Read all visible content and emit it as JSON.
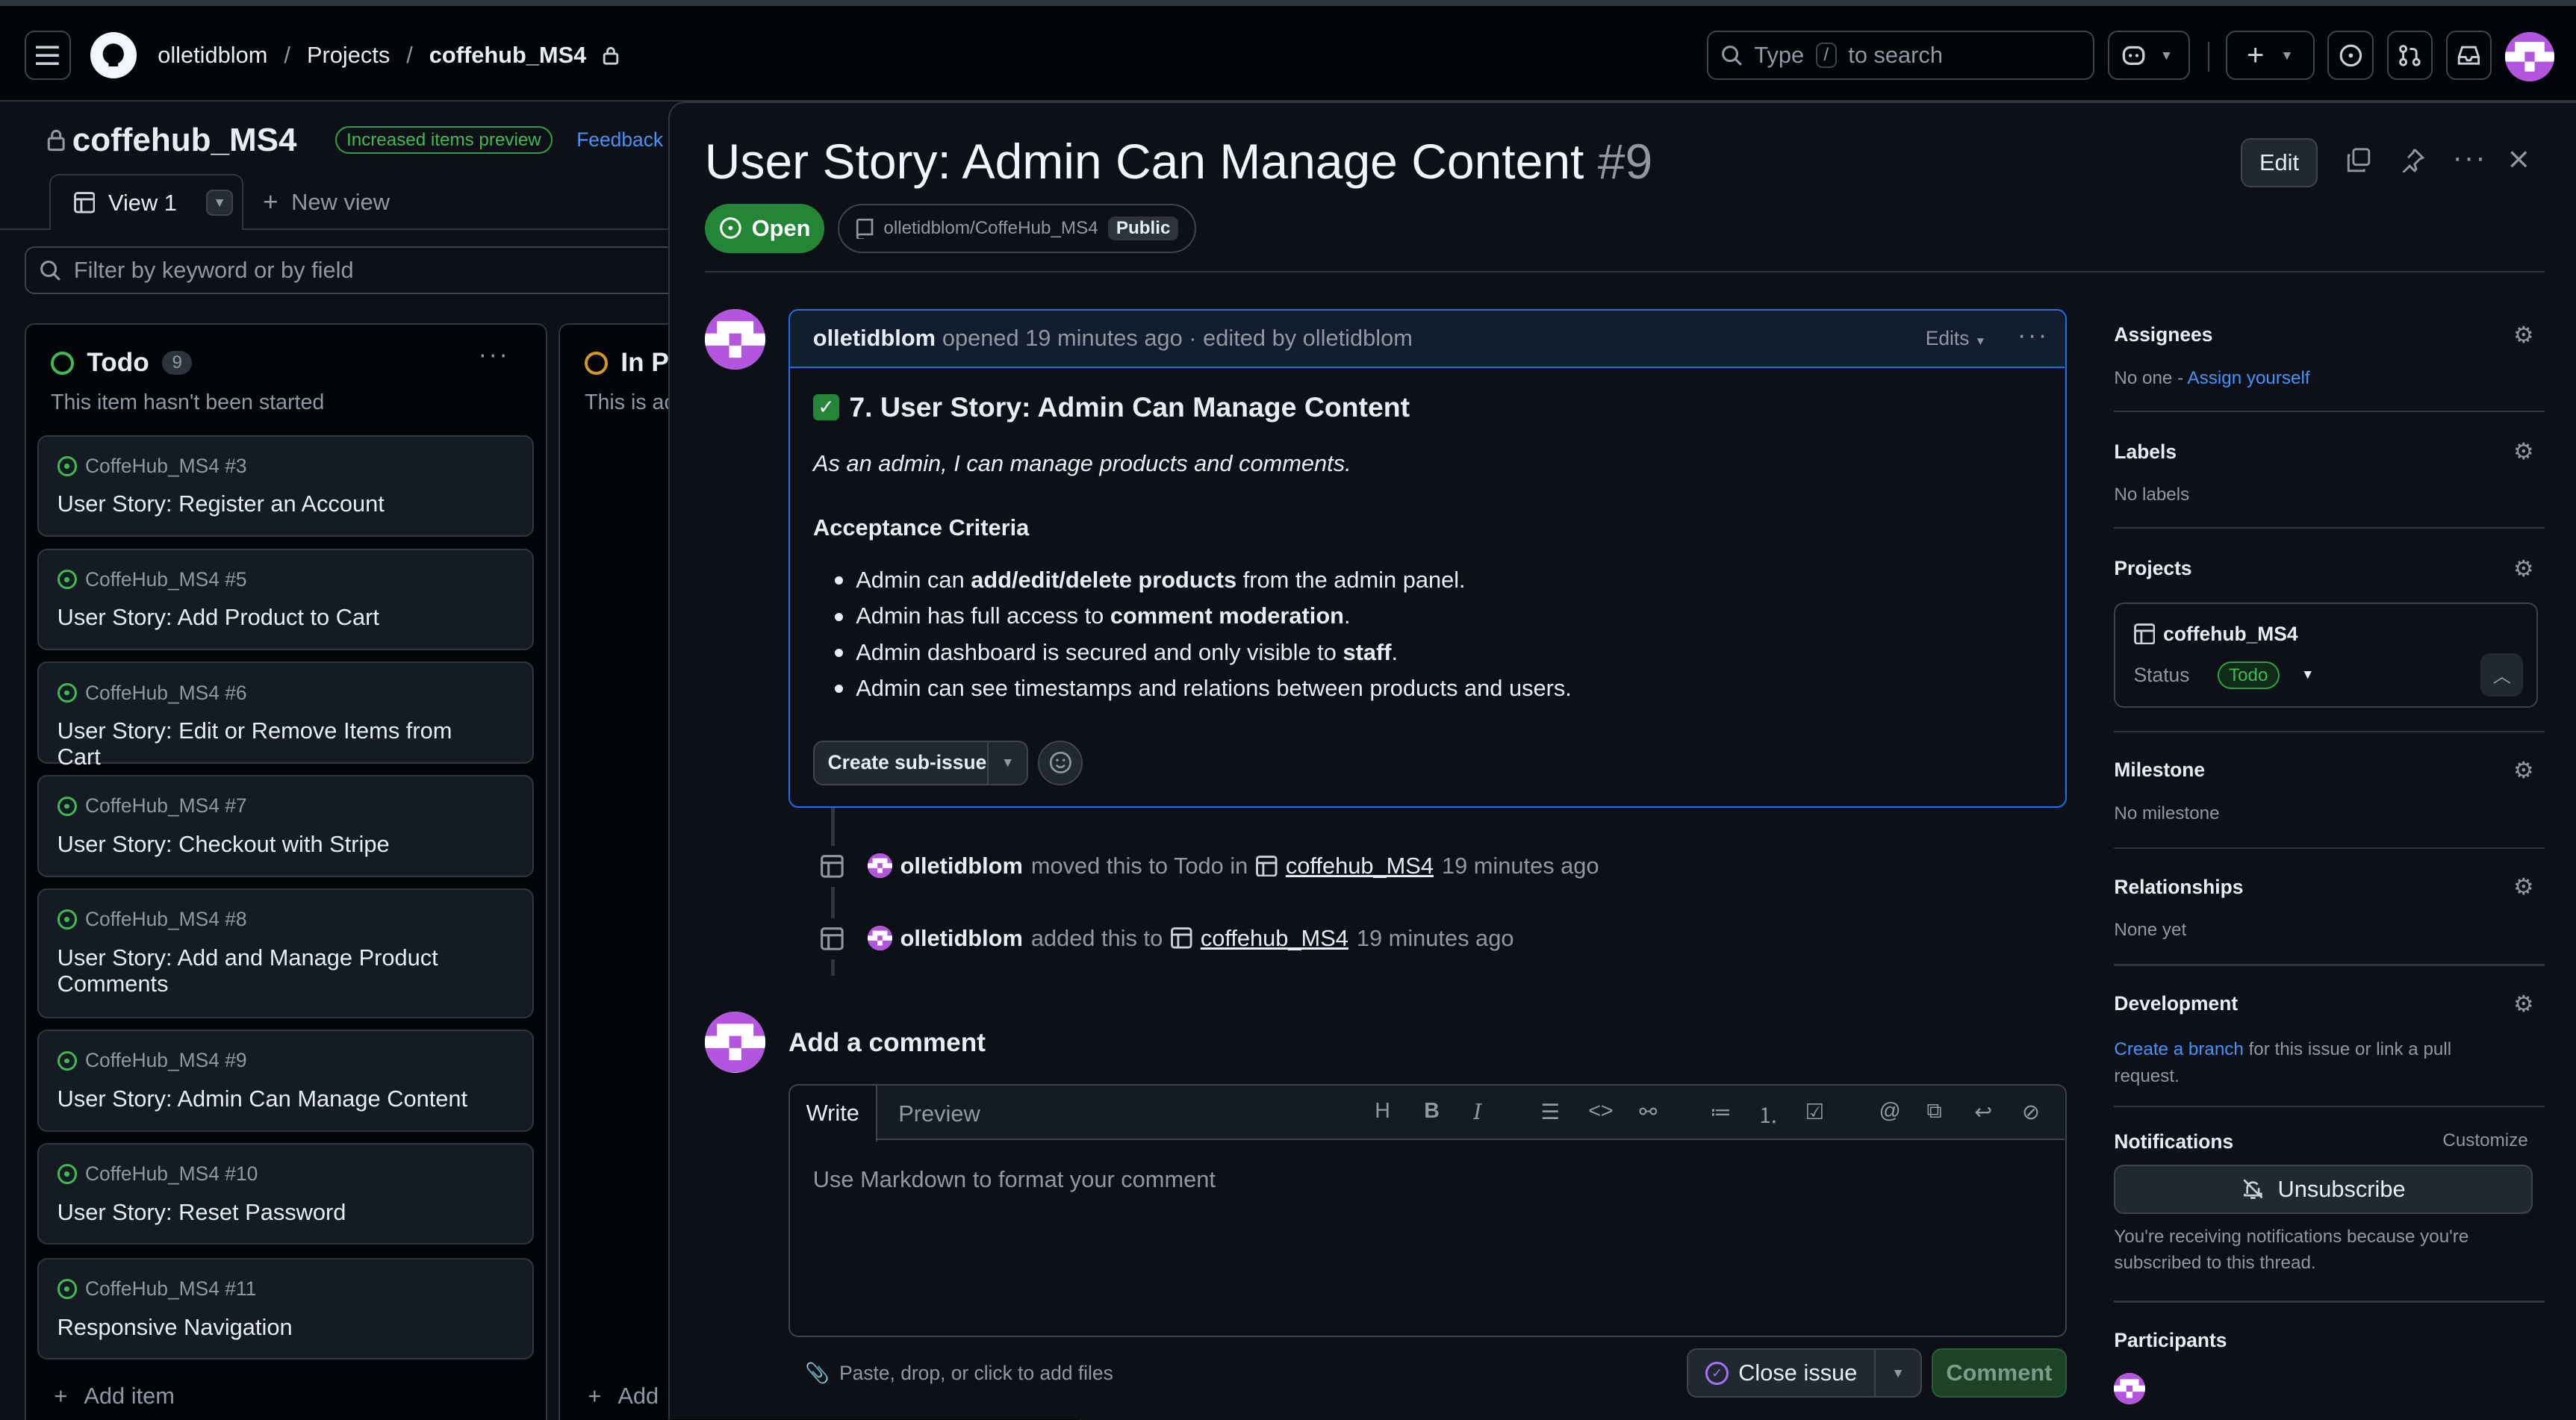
{
  "topbar": {
    "breadcrumb": [
      "olletidblom",
      "Projects",
      "coffehub_MS4"
    ],
    "search_prefix": "Type",
    "search_key": "/",
    "search_suffix": "to search"
  },
  "board": {
    "project_title": "coffehub_MS4",
    "preview_badge": "Increased items preview",
    "feedback": "Feedback",
    "view_tab": "View 1",
    "new_view": "New view",
    "filter_placeholder": "Filter by keyword or by field",
    "todo": {
      "title": "Todo",
      "count": "9",
      "description": "This item hasn't been started",
      "cards": [
        {
          "ref": "CoffeHub_MS4 #3",
          "title": "User Story: Register an Account"
        },
        {
          "ref": "CoffeHub_MS4 #5",
          "title": "User Story: Add Product to Cart"
        },
        {
          "ref": "CoffeHub_MS4 #6",
          "title": "User Story: Edit or Remove Items from Cart"
        },
        {
          "ref": "CoffeHub_MS4 #7",
          "title": "User Story: Checkout with Stripe"
        },
        {
          "ref": "CoffeHub_MS4 #8",
          "title": "User Story: Add and Manage Product Comments"
        },
        {
          "ref": "CoffeHub_MS4 #9",
          "title": "User Story: Admin Can Manage Content"
        },
        {
          "ref": "CoffeHub_MS4 #10",
          "title": "User Story: Reset Password"
        },
        {
          "ref": "CoffeHub_MS4 #11",
          "title": "Responsive Navigation"
        }
      ],
      "add_item": "Add item"
    },
    "in_progress": {
      "title": "In Pr",
      "description": "This is ac",
      "add_item": "Add"
    }
  },
  "issue": {
    "title": "User Story: Admin Can Manage Content",
    "number": "#9",
    "edit": "Edit",
    "state": "Open",
    "repo": "olletidblom/CoffeHub_MS4",
    "visibility": "Public",
    "author": "olletidblom",
    "meta": "opened 19 minutes ago · edited by olletidblom",
    "edits": "Edits",
    "heading": "7. User Story: Admin Can Manage Content",
    "lead": "As an admin, I can manage products and comments.",
    "criteria_heading": "Acceptance Criteria",
    "criteria": [
      {
        "pre": "Admin can ",
        "bold": "add/edit/delete products",
        "post": " from the admin panel."
      },
      {
        "pre": "Admin has full access to ",
        "bold": "comment moderation",
        "post": "."
      },
      {
        "pre": "Admin dashboard is secured and only visible to ",
        "bold": "staff",
        "post": "."
      },
      {
        "pre": "Admin can see timestamps and relations between products and users.",
        "bold": "",
        "post": ""
      }
    ],
    "create_sub_issue": "Create sub-issue"
  },
  "timeline": [
    {
      "user": "olletidblom",
      "action": "moved this to Todo in",
      "project": "coffehub_MS4",
      "time": "19 minutes ago"
    },
    {
      "user": "olletidblom",
      "action": "added this to",
      "project": "coffehub_MS4",
      "time": "19 minutes ago"
    }
  ],
  "comment": {
    "heading": "Add a comment",
    "tab_write": "Write",
    "tab_preview": "Preview",
    "placeholder": "Use Markdown to format your comment",
    "attach": "Paste, drop, or click to add files",
    "close_issue": "Close issue",
    "submit": "Comment"
  },
  "sidebar": {
    "assignees_label": "Assignees",
    "assignees_value": "No one - ",
    "assign_yourself": "Assign yourself",
    "labels_label": "Labels",
    "labels_value": "No labels",
    "projects_label": "Projects",
    "project_name": "coffehub_MS4",
    "status_label": "Status",
    "status_value": "Todo",
    "milestone_label": "Milestone",
    "milestone_value": "No milestone",
    "relationships_label": "Relationships",
    "relationships_value": "None yet",
    "development_label": "Development",
    "create_branch": "Create a branch",
    "development_value": " for this issue or link a pull request.",
    "notifications_label": "Notifications",
    "customize": "Customize",
    "unsubscribe": "Unsubscribe",
    "notifications_note": "You're receiving notifications because you're subscribed to this thread.",
    "participants_label": "Participants"
  },
  "colors": {
    "accent": "#4493f8",
    "open": "#238636",
    "todo": "#3fb950",
    "in_progress": "#d29922"
  }
}
